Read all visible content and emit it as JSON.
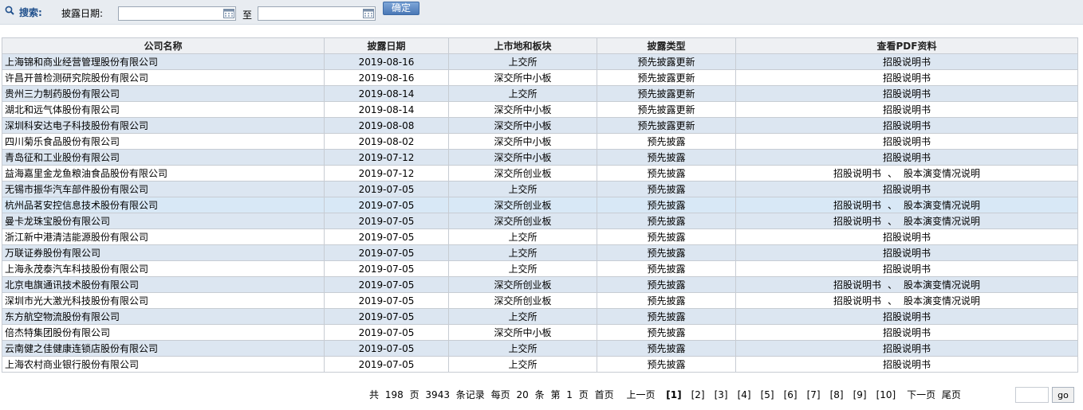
{
  "search": {
    "label": "搜索:",
    "date_label": "披露日期:",
    "start_value": "",
    "end_value": "",
    "to_label": "至",
    "confirm_label": "确定"
  },
  "table": {
    "headers": [
      "公司名称",
      "披露日期",
      "上市地和板块",
      "披露类型",
      "查看PDF资料"
    ],
    "rows": [
      {
        "company": "上海锦和商业经营管理股份有限公司",
        "date": "2019-08-16",
        "market": "上交所",
        "type": "预先披露更新",
        "docs": [
          "招股说明书"
        ]
      },
      {
        "company": "许昌开普检测研究院股份有限公司",
        "date": "2019-08-16",
        "market": "深交所中小板",
        "type": "预先披露更新",
        "docs": [
          "招股说明书"
        ]
      },
      {
        "company": "贵州三力制药股份有限公司",
        "date": "2019-08-14",
        "market": "上交所",
        "type": "预先披露更新",
        "docs": [
          "招股说明书"
        ]
      },
      {
        "company": "湖北和远气体股份有限公司",
        "date": "2019-08-14",
        "market": "深交所中小板",
        "type": "预先披露更新",
        "docs": [
          "招股说明书"
        ]
      },
      {
        "company": "深圳科安达电子科技股份有限公司",
        "date": "2019-08-08",
        "market": "深交所中小板",
        "type": "预先披露更新",
        "docs": [
          "招股说明书"
        ]
      },
      {
        "company": "四川菊乐食品股份有限公司",
        "date": "2019-08-02",
        "market": "深交所中小板",
        "type": "预先披露",
        "docs": [
          "招股说明书"
        ]
      },
      {
        "company": "青岛征和工业股份有限公司",
        "date": "2019-07-12",
        "market": "深交所中小板",
        "type": "预先披露",
        "docs": [
          "招股说明书"
        ]
      },
      {
        "company": "益海嘉里金龙鱼粮油食品股份有限公司",
        "date": "2019-07-12",
        "market": "深交所创业板",
        "type": "预先披露",
        "docs": [
          "招股说明书",
          "股本演变情况说明"
        ]
      },
      {
        "company": "无锡市振华汽车部件股份有限公司",
        "date": "2019-07-05",
        "market": "上交所",
        "type": "预先披露",
        "docs": [
          "招股说明书"
        ]
      },
      {
        "company": "杭州品茗安控信息技术股份有限公司",
        "date": "2019-07-05",
        "market": "深交所创业板",
        "type": "预先披露",
        "docs": [
          "招股说明书",
          "股本演变情况说明"
        ]
      },
      {
        "company": "曼卡龙珠宝股份有限公司",
        "date": "2019-07-05",
        "market": "深交所创业板",
        "type": "预先披露",
        "docs": [
          "招股说明书",
          "股本演变情况说明"
        ]
      },
      {
        "company": "浙江新中港清洁能源股份有限公司",
        "date": "2019-07-05",
        "market": "上交所",
        "type": "预先披露",
        "docs": [
          "招股说明书"
        ]
      },
      {
        "company": "万联证券股份有限公司",
        "date": "2019-07-05",
        "market": "上交所",
        "type": "预先披露",
        "docs": [
          "招股说明书"
        ]
      },
      {
        "company": "上海永茂泰汽车科技股份有限公司",
        "date": "2019-07-05",
        "market": "上交所",
        "type": "预先披露",
        "docs": [
          "招股说明书"
        ]
      },
      {
        "company": "北京电旗通讯技术股份有限公司",
        "date": "2019-07-05",
        "market": "深交所创业板",
        "type": "预先披露",
        "docs": [
          "招股说明书",
          "股本演变情况说明"
        ]
      },
      {
        "company": "深圳市光大激光科技股份有限公司",
        "date": "2019-07-05",
        "market": "深交所创业板",
        "type": "预先披露",
        "docs": [
          "招股说明书",
          "股本演变情况说明"
        ]
      },
      {
        "company": "东方航空物流股份有限公司",
        "date": "2019-07-05",
        "market": "上交所",
        "type": "预先披露",
        "docs": [
          "招股说明书"
        ]
      },
      {
        "company": "倍杰特集团股份有限公司",
        "date": "2019-07-05",
        "market": "深交所中小板",
        "type": "预先披露",
        "docs": [
          "招股说明书"
        ]
      },
      {
        "company": "云南健之佳健康连锁店股份有限公司",
        "date": "2019-07-05",
        "market": "上交所",
        "type": "预先披露",
        "docs": [
          "招股说明书"
        ]
      },
      {
        "company": "上海农村商业银行股份有限公司",
        "date": "2019-07-05",
        "market": "上交所",
        "type": "预先披露",
        "docs": [
          "招股说明书"
        ]
      }
    ],
    "doc_separator": "、"
  },
  "pager": {
    "summary": [
      "共",
      "198",
      "页",
      "3943",
      "条记录",
      "每页",
      "20",
      "条",
      "第",
      "1",
      "页"
    ],
    "first": "首页",
    "prev": "上一页",
    "pages": [
      "[1]",
      "[2]",
      "[3]",
      "[4]",
      "[5]",
      "[6]",
      "[7]",
      "[8]",
      "[9]",
      "[10]"
    ],
    "current": "[1]",
    "next": "下一页",
    "last": "尾页",
    "go_label": "go",
    "go_value": ""
  },
  "colors": {
    "row_alt": "#dce6f1",
    "header_bg": "#eef0f3",
    "search_bar": "#e8ecf1",
    "accent": "#1f4f8c"
  }
}
